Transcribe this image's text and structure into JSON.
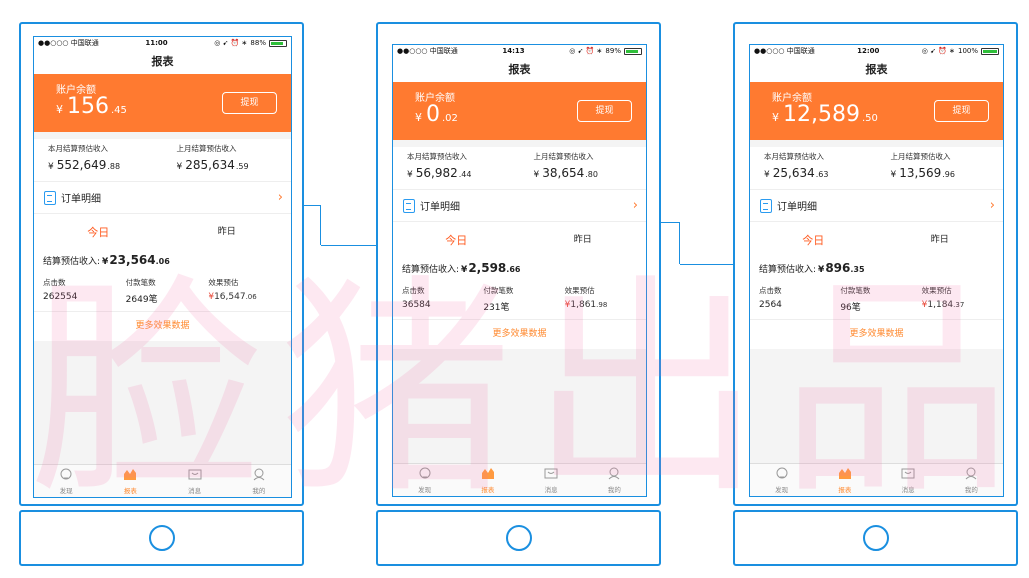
{
  "watermark": "脸猪出品",
  "status": {
    "carrier": "●●○○○ 中国联通",
    "icons": "◎ ➹ ⏰ ∗"
  },
  "nav_title": "报表",
  "balance_label": "账户余额",
  "withdraw_label": "提现",
  "this_month_label": "本月结算预估收入",
  "last_month_label": "上月结算预估收入",
  "order_label": "订单明细",
  "tab_today": "今日",
  "tab_yesterday": "昨日",
  "summary_label": "结算预估收入:",
  "metric_clicks_label": "点击数",
  "metric_orders_label": "付款笔数",
  "metric_effect_label": "效果预估",
  "more_label": "更多效果数据",
  "currency": "¥",
  "tabbar": [
    "发现",
    "报表",
    "消息",
    "我的"
  ],
  "colors": {
    "accent": "#ff7a30",
    "frame": "#1a8fe0",
    "battery": "#2fbf3a"
  },
  "phones": [
    {
      "time": "11:00",
      "battery": "88%",
      "battery_level": 0.88,
      "balance_int": "156",
      "balance_dec": ".45",
      "this_month_int": "552,649",
      "this_month_dec": ".88",
      "last_month_int": "285,634",
      "last_month_dec": ".59",
      "today_int": "23,564",
      "today_dec": ".06",
      "clicks": "262554",
      "orders": "2649笔",
      "effect_int": "16,547",
      "effect_dec": ".06"
    },
    {
      "time": "14:13",
      "battery": "89%",
      "battery_level": 0.89,
      "balance_int": "0",
      "balance_dec": ".02",
      "this_month_int": "56,982",
      "this_month_dec": ".44",
      "last_month_int": "38,654",
      "last_month_dec": ".80",
      "today_int": "2,598",
      "today_dec": ".66",
      "clicks": "36584",
      "orders": "231笔",
      "effect_int": "1,861",
      "effect_dec": ".98"
    },
    {
      "time": "12:00",
      "battery": "100%",
      "battery_level": 1.0,
      "balance_int": "12,589",
      "balance_dec": ".50",
      "this_month_int": "25,634",
      "this_month_dec": ".63",
      "last_month_int": "13,569",
      "last_month_dec": ".96",
      "today_int": "896",
      "today_dec": ".35",
      "clicks": "2564",
      "orders": "96笔",
      "effect_int": "1,184",
      "effect_dec": ".37"
    }
  ]
}
